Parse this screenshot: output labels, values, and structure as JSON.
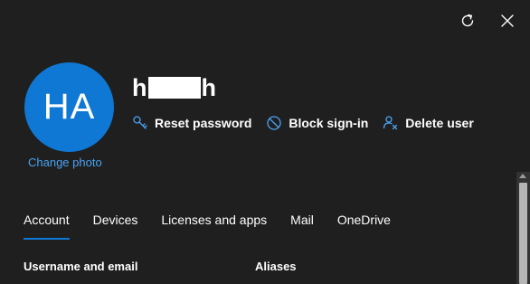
{
  "header": {
    "refresh_icon": "refresh-icon",
    "close_icon": "close-icon"
  },
  "user": {
    "initials": "HA",
    "change_photo_label": "Change photo",
    "name_first_visible": "h",
    "name_last_visible": "h"
  },
  "actions": [
    {
      "icon": "key-icon",
      "label": "Reset password"
    },
    {
      "icon": "block-icon",
      "label": "Block sign-in"
    },
    {
      "icon": "delete-user-icon",
      "label": "Delete user"
    }
  ],
  "tabs": [
    {
      "label": "Account",
      "active": true
    },
    {
      "label": "Devices",
      "active": false
    },
    {
      "label": "Licenses and apps",
      "active": false
    },
    {
      "label": "Mail",
      "active": false
    },
    {
      "label": "OneDrive",
      "active": false
    }
  ],
  "sections": {
    "username_heading": "Username and email",
    "aliases_heading": "Aliases"
  },
  "colors": {
    "background": "#1f1f1f",
    "avatar": "#0f78d4",
    "link": "#4aa3f2",
    "icon_accent": "#4aa3f2"
  }
}
